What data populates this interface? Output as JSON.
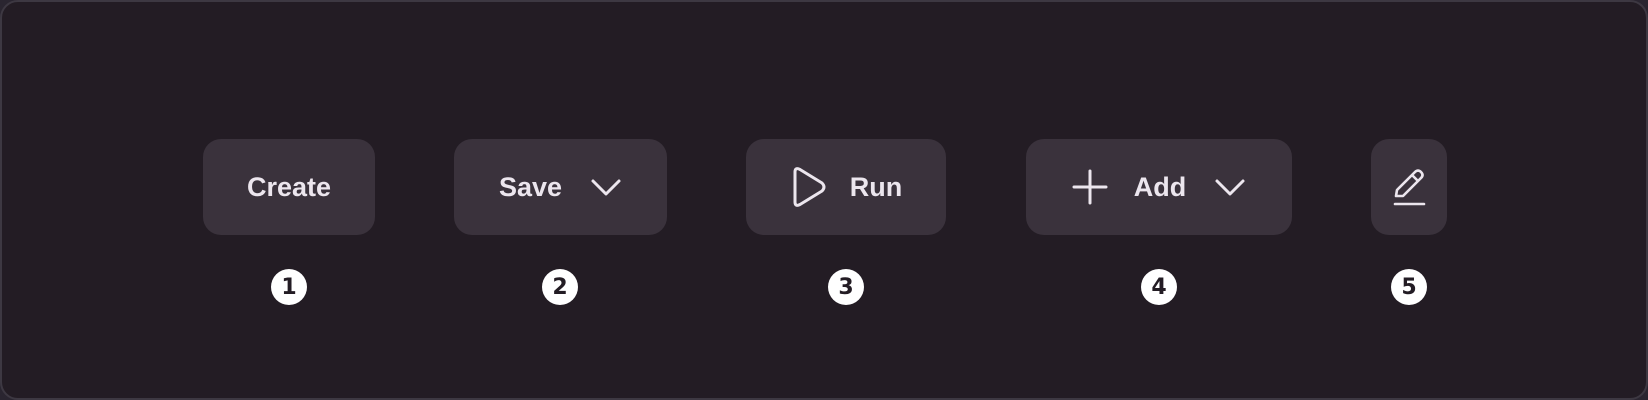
{
  "buttons": {
    "create": {
      "label": "Create"
    },
    "save": {
      "label": "Save",
      "icon": "chevron-down-icon"
    },
    "run": {
      "label": "Run",
      "icon": "play-icon"
    },
    "add": {
      "label": "Add",
      "icons": [
        "plus-icon",
        "chevron-down-icon"
      ]
    },
    "edit": {
      "icon": "pencil-icon"
    }
  },
  "badges": [
    "1",
    "2",
    "3",
    "4",
    "5"
  ],
  "colors": {
    "background": "#231c24",
    "button": "#3a323c",
    "text": "#ece6ee",
    "badge": "#ffffff"
  }
}
